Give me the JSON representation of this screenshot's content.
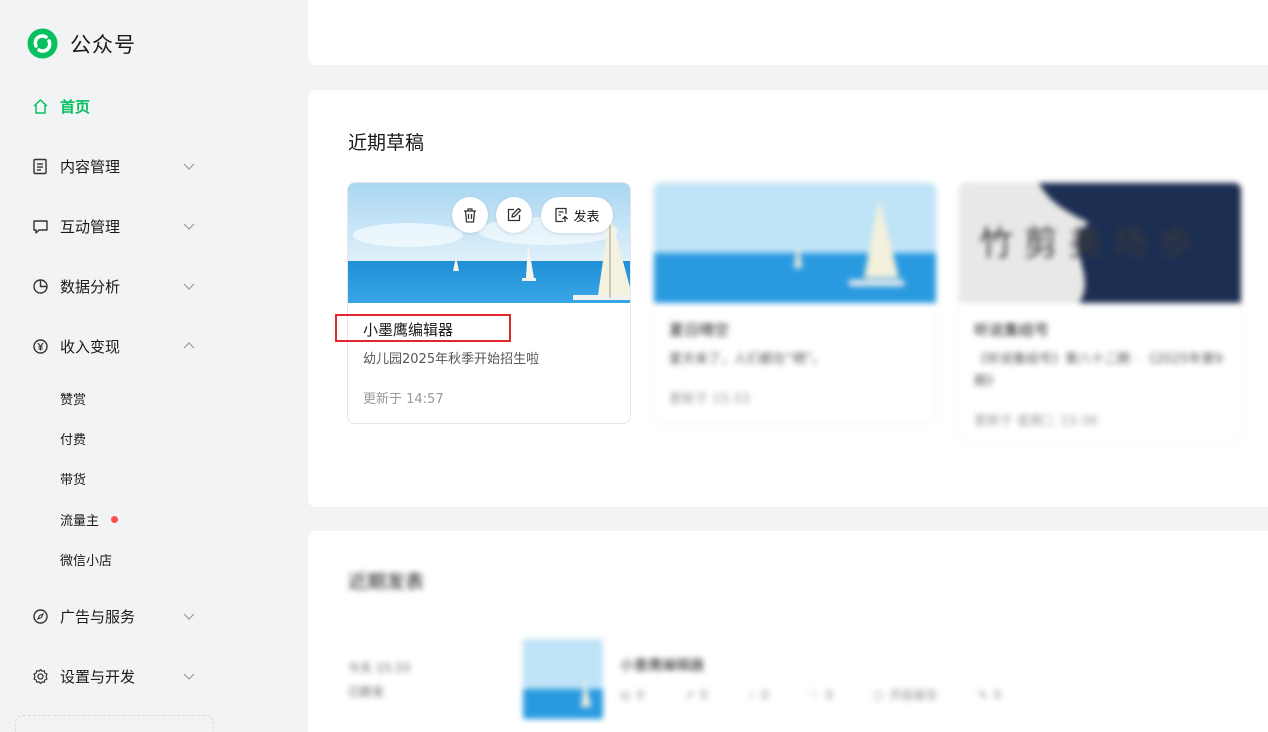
{
  "brand": {
    "name": "公众号",
    "accent": "#07c160"
  },
  "nav": {
    "home": "首页",
    "content": "内容管理",
    "interaction": "互动管理",
    "analytics": "数据分析",
    "monetize": "收入变现",
    "monetize_sub": [
      "赞赏",
      "付费",
      "带货",
      "流量主",
      "微信小店"
    ],
    "ads": "广告与服务",
    "settings": "设置与开发"
  },
  "drafts": {
    "section_title": "近期草稿",
    "publish_label": "发表",
    "cards": [
      {
        "title": "小墨鹰编辑器",
        "desc": "幼儿园2025年秋季开始招生啦",
        "time": "更新于 14:57"
      },
      {
        "title": "夏日晴空",
        "desc": "夏天来了，人们都在“晒”。",
        "time": "更新于 15:33"
      },
      {
        "title": "听说集结号",
        "desc": "《听说集结号》第八十二期 · 《2025年第9期》",
        "time": "更新于 星期二 15:36"
      }
    ]
  },
  "recent": {
    "section_title": "近期发表",
    "time": "今天 15:33",
    "status": "已群发",
    "article_title": "小墨鹰编辑器",
    "stats": [
      "0",
      "0",
      "0",
      "0",
      "开启留言",
      "0"
    ]
  }
}
